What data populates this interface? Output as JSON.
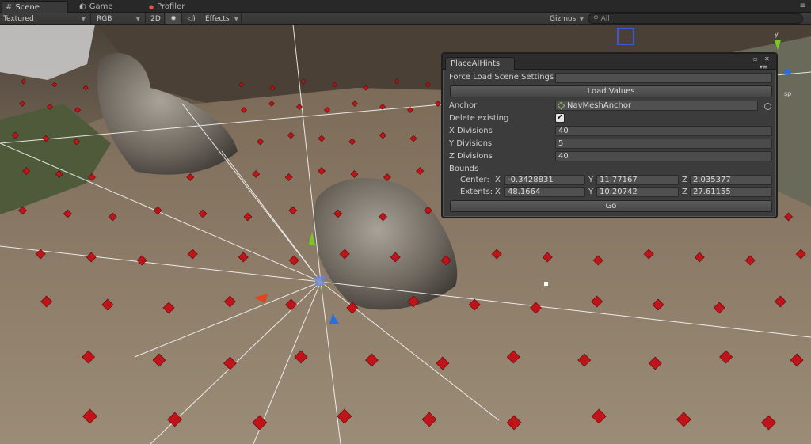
{
  "tabs": [
    {
      "label": "Scene",
      "icon": "grid-icon",
      "active": true
    },
    {
      "label": "Game",
      "icon": "pacman-icon",
      "active": false
    },
    {
      "label": "Profiler",
      "icon": "record-dot-icon",
      "active": false
    }
  ],
  "toolbar": {
    "render_mode": "Textured",
    "color_mode": "RGB",
    "two_d_label": "2D",
    "effects_label": "Effects",
    "gizmos_label": "Gizmos",
    "search_placeholder": "All"
  },
  "window": {
    "tab_title": "PlaceAIHints",
    "force_load_label": "Force Load Scene Settings",
    "force_load_value": "",
    "load_values_button": "Load Values",
    "anchor_label": "Anchor",
    "anchor_value": "NavMeshAnchor",
    "delete_existing_label": "Delete existing",
    "delete_existing_checked": true,
    "delete_existing_mark": "✔",
    "x_divisions_label": "X Divisions",
    "x_divisions_value": "40",
    "y_divisions_label": "Y Divisions",
    "y_divisions_value": "5",
    "z_divisions_label": "Z Divisions",
    "z_divisions_value": "40",
    "bounds_label": "Bounds",
    "center_label": "Center:",
    "extents_label": "Extents:",
    "axis_x": "X",
    "axis_y": "Y",
    "axis_z": "Z",
    "center": {
      "x": "-0.3428831",
      "y": "11.77167",
      "z": "2.035377"
    },
    "extents": {
      "x": "48.1664",
      "y": "10.20742",
      "z": "27.61155"
    },
    "go_button": "Go"
  },
  "scene": {
    "gizmo_y_label": "y",
    "persp_label": "sp",
    "marker_color": "#c0141a",
    "accent_red": "#e0461e",
    "accent_green": "#7ac823",
    "accent_blue": "#2a6ee0"
  }
}
